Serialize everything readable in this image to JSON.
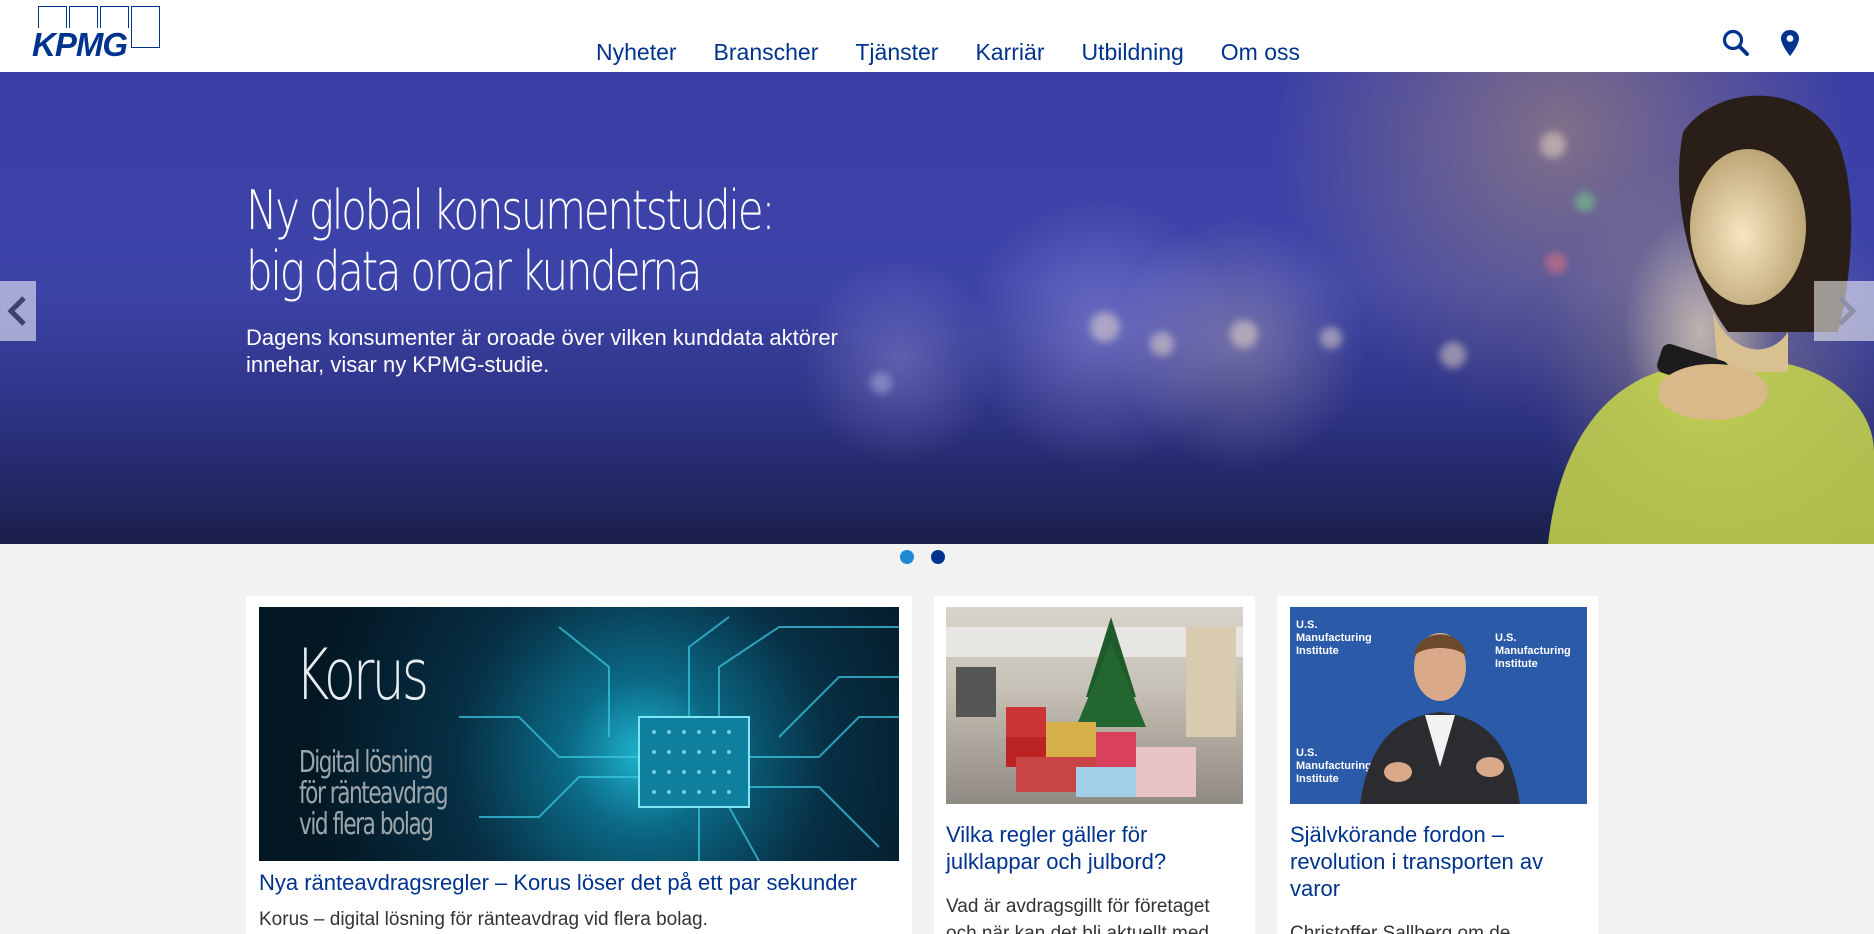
{
  "brand": {
    "logo_text": "KPMG",
    "color": "#00338d"
  },
  "nav": {
    "items": [
      "Nyheter",
      "Branscher",
      "Tjänster",
      "Karriär",
      "Utbildning",
      "Om oss"
    ]
  },
  "header_icons": [
    "search-icon",
    "location-pin-icon"
  ],
  "hero": {
    "title": "Ny global konsumentstudie: big data oroar kunderna",
    "subtitle": "Dagens konsumenter är oroade över vilken kunddata aktörer innehar, visar ny KPMG-studie.",
    "slide_count": 2,
    "active_slide": 1
  },
  "cards": [
    {
      "image_text": "Korus",
      "image_subtext": [
        "Digital lösning",
        "för ränteavdrag",
        "vid flera bolag"
      ],
      "title": "Nya ränteavdragsregler – Korus löser det på ett par sekunder",
      "text": "Korus – digital lösning för ränteavdrag vid flera bolag."
    },
    {
      "title": "Vilka regler gäller för julklappar och julbord?",
      "text": "Vad är avdragsgillt för företaget och när kan det bli aktuellt med"
    },
    {
      "image_banner_text": [
        "U.S.",
        "Manufacturing",
        "Institute"
      ],
      "title": "Självkörande fordon – revolution i transporten av varor",
      "text": "Christoffer Sallberg om de"
    }
  ]
}
